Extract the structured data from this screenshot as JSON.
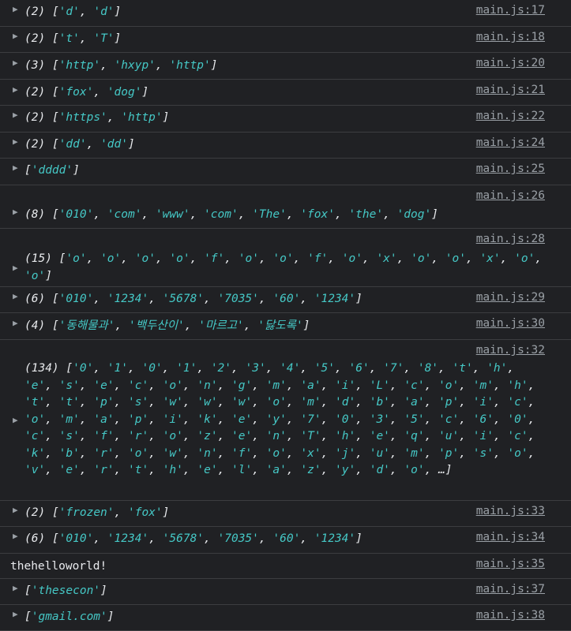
{
  "rows": [
    {
      "src": "main.js:17",
      "count": "(2)",
      "items": [
        "d",
        "d"
      ],
      "h": 34,
      "srcTop": 5,
      "msgTop": 5
    },
    {
      "src": "main.js:18",
      "count": "(2)",
      "items": [
        "t",
        "T"
      ],
      "h": 33,
      "srcTop": 5,
      "msgTop": 5
    },
    {
      "src": "main.js:20",
      "count": "(3)",
      "items": [
        "http",
        "hxyp",
        "http"
      ],
      "h": 34,
      "srcTop": 5,
      "msgTop": 6
    },
    {
      "src": "main.js:21",
      "count": "(2)",
      "items": [
        "fox",
        "dog"
      ],
      "h": 33,
      "srcTop": 5,
      "msgTop": 6
    },
    {
      "src": "main.js:22",
      "count": "(2)",
      "items": [
        "https",
        "http"
      ],
      "h": 34,
      "srcTop": 5,
      "msgTop": 5
    },
    {
      "src": "main.js:24",
      "count": "(2)",
      "items": [
        "dd",
        "dd"
      ],
      "h": 33,
      "srcTop": 5,
      "msgTop": 5
    },
    {
      "src": "main.js:25",
      "count": "",
      "items": [
        "dddd"
      ],
      "h": 34,
      "srcTop": 5,
      "msgTop": 5
    },
    {
      "src": "main.js:26",
      "count": "(8)",
      "items": [
        "010",
        "com",
        "www",
        "com",
        "The",
        "fox",
        "the",
        "dog"
      ],
      "h": 55,
      "srcTop": 5,
      "msgTop": 27
    },
    {
      "src": "main.js:28",
      "count": "(15)",
      "items": [
        "o",
        "o",
        "o",
        "o",
        "f",
        "o",
        "o",
        "f",
        "o",
        "x",
        "o",
        "o",
        "x",
        "o",
        "o"
      ],
      "h": 74,
      "srcTop": 5,
      "msgTop": 28
    },
    {
      "src": "main.js:29",
      "count": "(6)",
      "items": [
        "010",
        "1234",
        "5678",
        "7035",
        "60",
        "1234"
      ],
      "h": 33,
      "srcTop": 5,
      "msgTop": 5
    },
    {
      "src": "main.js:30",
      "count": "(4)",
      "items": [
        "동해물과",
        "백두산이",
        "마르고",
        "닳도록"
      ],
      "h": 34,
      "srcTop": 5,
      "msgTop": 6
    },
    {
      "src": "main.js:32",
      "count": "(134)",
      "items": [
        "0",
        "1",
        "0",
        "1",
        "2",
        "3",
        "4",
        "5",
        "6",
        "7",
        "8",
        "t",
        "h",
        "e",
        "s",
        "e",
        "c",
        "o",
        "n",
        "g",
        "m",
        "a",
        "i",
        "L",
        "c",
        "o",
        "m",
        "h",
        "t",
        "t",
        "p",
        "s",
        "w",
        "w",
        "w",
        "o",
        "m",
        "d",
        "b",
        "a",
        "p",
        "i",
        "c",
        "o",
        "m",
        "a",
        "p",
        "i",
        "k",
        "e",
        "y",
        "7",
        "0",
        "3",
        "5",
        "c",
        "6",
        "0",
        "c",
        "s",
        "f",
        "r",
        "o",
        "z",
        "e",
        "n",
        "T",
        "h",
        "e",
        "q",
        "u",
        "i",
        "c",
        "k",
        "b",
        "r",
        "o",
        "w",
        "n",
        "f",
        "o",
        "x",
        "j",
        "u",
        "m",
        "p",
        "s",
        "o",
        "v",
        "e",
        "r",
        "t",
        "h",
        "e",
        "l",
        "a",
        "z",
        "y",
        "d",
        "o"
      ],
      "ellipsis": "…",
      "h": 204,
      "srcTop": 5,
      "msgTop": 27
    },
    {
      "src": "main.js:33",
      "count": "(2)",
      "items": [
        "frozen",
        "fox"
      ],
      "h": 33,
      "srcTop": 5,
      "msgTop": 5
    },
    {
      "src": "main.js:34",
      "count": "(6)",
      "items": [
        "010",
        "1234",
        "5678",
        "7035",
        "60",
        "1234"
      ],
      "h": 34,
      "srcTop": 5,
      "msgTop": 5
    },
    {
      "src": "main.js:35",
      "text": "thehelloworld!",
      "h": 32,
      "srcTop": 5,
      "msgTop": 6
    },
    {
      "src": "main.js:37",
      "count": "",
      "items": [
        "thesecon"
      ],
      "h": 33,
      "srcTop": 5,
      "msgTop": 5
    },
    {
      "src": "main.js:38",
      "count": "",
      "items": [
        "gmail.com"
      ],
      "h": 33,
      "srcTop": 5,
      "msgTop": 5
    }
  ]
}
